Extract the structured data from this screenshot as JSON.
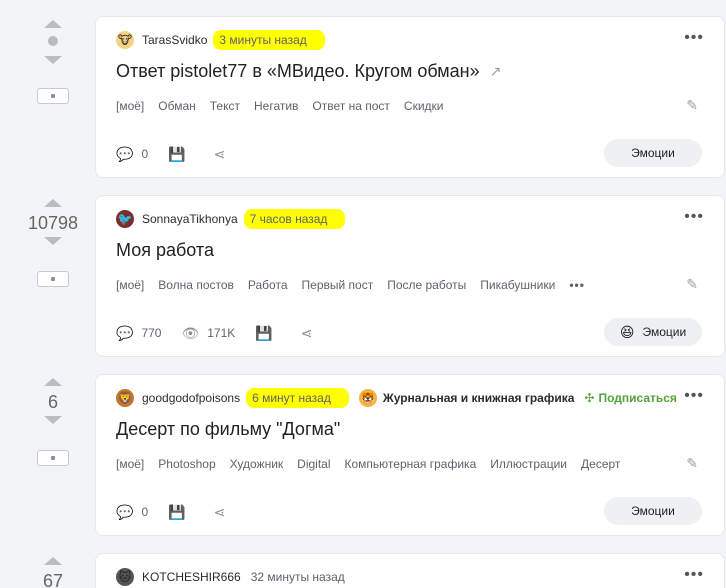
{
  "posts": [
    {
      "rating": "",
      "author": "TarasSvidko",
      "avatar_icon": "🐮",
      "time": "3 минуты назад",
      "title": "Ответ pistolet77 в «МВидео. Кругом обман»",
      "tags": [
        "[моё]",
        "Обман",
        "Текст",
        "Негатив",
        "Ответ на пост",
        "Скидки"
      ],
      "comments": "0",
      "views": "",
      "emotion_label": "Эмоции"
    },
    {
      "rating": "10798",
      "author": "SonnayaTikhonya",
      "avatar_icon": "🐦",
      "time": "7 часов назад",
      "title": "Моя работа",
      "tags": [
        "[моё]",
        "Волна постов",
        "Работа",
        "Первый пост",
        "После работы",
        "Пикабушники"
      ],
      "comments": "770",
      "views": "171K",
      "emotion_label": "Эмоции"
    },
    {
      "rating": "6",
      "author": "goodgodofpoisons",
      "avatar_icon": "🦁",
      "time": "6 минут назад",
      "community": "Журнальная и книжная графика",
      "subscribe": "Подписаться",
      "title": "Десерт по фильму \"Догма\"",
      "tags": [
        "[моё]",
        "Photoshop",
        "Художник",
        "Digital",
        "Компьютерная графика",
        "Иллюстрации",
        "Десерт"
      ],
      "comments": "0",
      "views": "",
      "emotion_label": "Эмоции"
    },
    {
      "rating": "67",
      "author": "KOTCHESHIR666",
      "avatar_icon": "🐱",
      "time": "32 минуты назад"
    }
  ]
}
